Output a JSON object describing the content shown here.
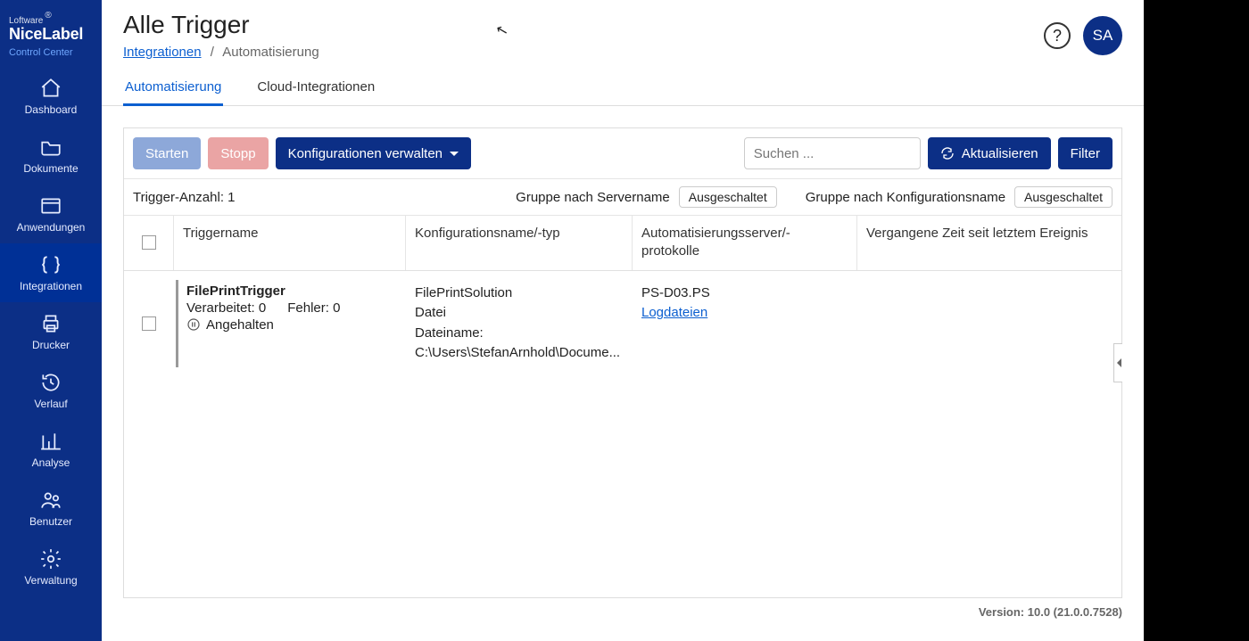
{
  "brand": {
    "company": "Loftware",
    "product": "NiceLabel",
    "module": "Control Center"
  },
  "sidebar": {
    "items": [
      {
        "id": "dashboard",
        "label": "Dashboard"
      },
      {
        "id": "documents",
        "label": "Dokumente"
      },
      {
        "id": "applications",
        "label": "Anwendungen"
      },
      {
        "id": "integrations",
        "label": "Integrationen"
      },
      {
        "id": "printers",
        "label": "Drucker"
      },
      {
        "id": "history",
        "label": "Verlauf"
      },
      {
        "id": "analysis",
        "label": "Analyse"
      },
      {
        "id": "users",
        "label": "Benutzer"
      },
      {
        "id": "admin",
        "label": "Verwaltung"
      }
    ],
    "active": "integrations"
  },
  "header": {
    "title": "Alle Trigger",
    "breadcrumb_link": "Integrationen",
    "breadcrumb_current": "Automatisierung",
    "avatar_initials": "SA"
  },
  "tabs": [
    {
      "id": "automation",
      "label": "Automatisierung",
      "active": true
    },
    {
      "id": "cloud",
      "label": "Cloud-Integrationen",
      "active": false
    }
  ],
  "toolbar": {
    "start": "Starten",
    "stop": "Stopp",
    "manage_config": "Konfigurationen verwalten",
    "search_placeholder": "Suchen ...",
    "refresh": "Aktualisieren",
    "filter": "Filter"
  },
  "meta": {
    "trigger_count": "Trigger-Anzahl: 1",
    "group_server_label": "Gruppe nach Servername",
    "group_server_value": "Ausgeschaltet",
    "group_config_label": "Gruppe nach Konfigurationsname",
    "group_config_value": "Ausgeschaltet"
  },
  "columns": {
    "trigger": "Triggername",
    "config": "Konfigurationsname/-typ",
    "server": "Automatisierungsserver/-protokolle",
    "elapsed": "Vergangene Zeit seit letztem Ereignis"
  },
  "rows": [
    {
      "name": "FilePrintTrigger",
      "processed_label": "Verarbeitet: 0",
      "errors_label": "Fehler: 0",
      "status": "Angehalten",
      "config_name": "FilePrintSolution",
      "config_type": "Datei",
      "config_path_label": "Dateiname:",
      "config_path": "C:\\Users\\StefanArnhold\\Docume...",
      "server": "PS-D03.PS",
      "log_link": "Logdateien"
    }
  ],
  "footer": {
    "version": "Version: 10.0 (21.0.0.7528)"
  }
}
